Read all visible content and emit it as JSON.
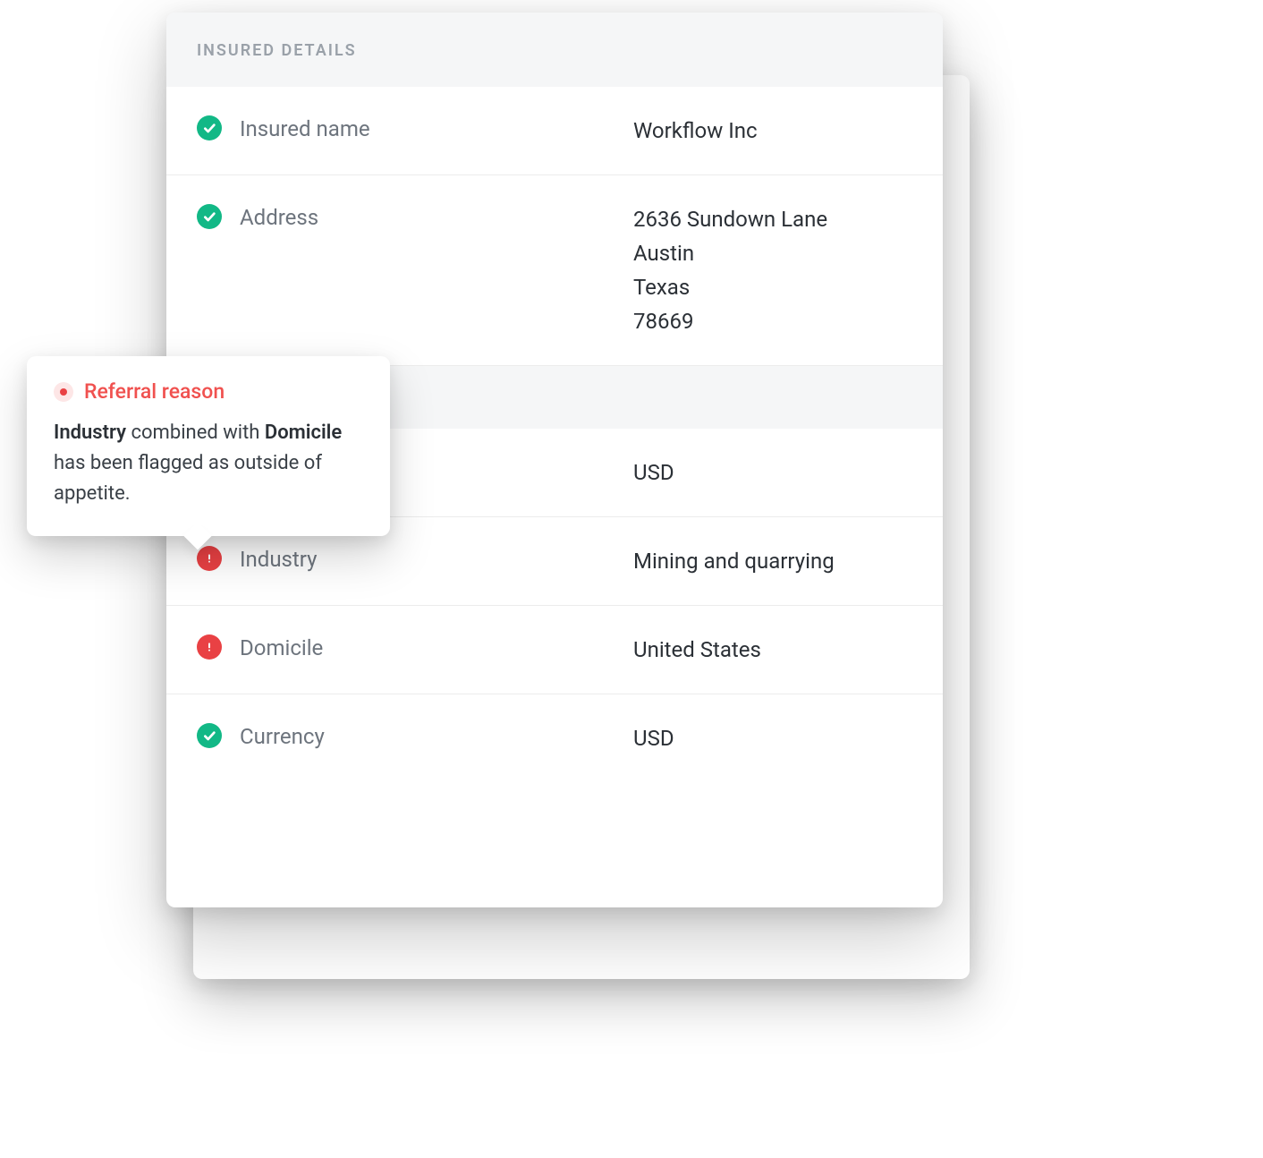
{
  "section_title": "INSURED DETAILS",
  "rows": [
    {
      "status": "ok",
      "label": "Insured name",
      "value": "Workflow Inc"
    },
    {
      "status": "ok",
      "label": "Address",
      "value": "2636 Sundown Lane\nAustin\nTexas\n78669"
    },
    {
      "status": "spacer"
    },
    {
      "status": "hidden",
      "label": "",
      "value": "USD"
    },
    {
      "status": "warn",
      "label": "Industry",
      "value": "Mining and quarrying"
    },
    {
      "status": "warn",
      "label": "Domicile",
      "value": "United States"
    },
    {
      "status": "ok",
      "label": "Currency",
      "value": "USD"
    }
  ],
  "popover": {
    "title": "Referral reason",
    "bold1": "Industry",
    "mid1": " combined with ",
    "bold2": "Domicile",
    "tail": " has been flagged as outside of appetite."
  }
}
